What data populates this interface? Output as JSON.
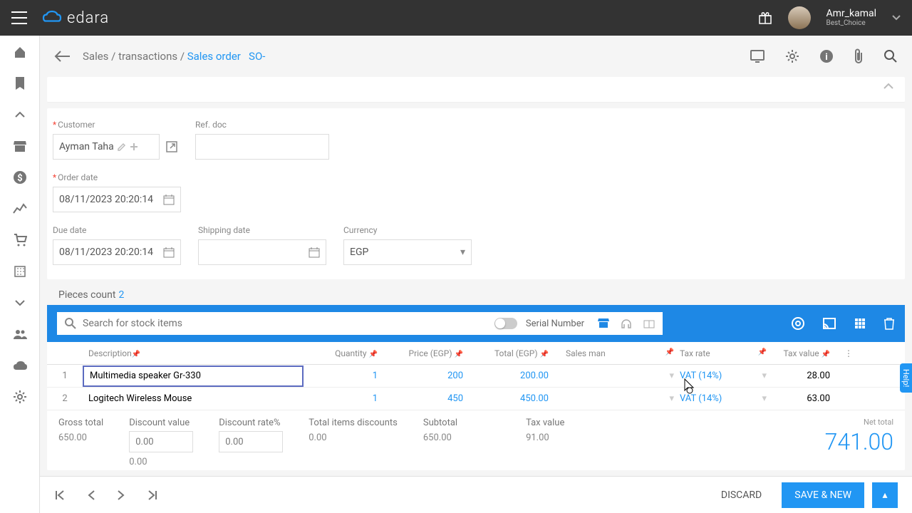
{
  "topbar": {
    "brand_text": "edara",
    "user_name": "Amr_kamal",
    "user_sub": "Best_Choice"
  },
  "breadcrumb": {
    "p1": "Sales",
    "p2": "transactions",
    "p3": "Sales order",
    "code": "SO-"
  },
  "form": {
    "customer_label": "Customer",
    "customer_value": "Ayman Taha",
    "ref_label": "Ref. doc",
    "order_date_label": "Order date",
    "order_date_value": "08/11/2023 20:20:14",
    "due_date_label": "Due date",
    "due_date_value": "08/11/2023 20:20:14",
    "shipping_label": "Shipping date",
    "currency_label": "Currency",
    "currency_value": "EGP"
  },
  "pieces": {
    "label": "Pieces count",
    "value": "2"
  },
  "search": {
    "placeholder": "Search for stock items",
    "serial": "Serial Number"
  },
  "columns": {
    "desc": "Description",
    "qty": "Quantity",
    "price": "Price (EGP)",
    "total": "Total (EGP)",
    "sales": "Sales man",
    "tax": "Tax rate",
    "taxv": "Tax value"
  },
  "rows": [
    {
      "n": "1",
      "desc": "Multimedia speaker Gr-330",
      "qty": "1",
      "price": "200",
      "total": "200.00",
      "tax": "VAT (14%)",
      "taxv": "28.00"
    },
    {
      "n": "2",
      "desc": "Logitech Wireless Mouse",
      "qty": "1",
      "price": "450",
      "total": "450.00",
      "tax": "VAT (14%)",
      "taxv": "63.00"
    }
  ],
  "totals": {
    "gross_l": "Gross total",
    "gross_v": "650.00",
    "discv_l": "Discount value",
    "discv_v": "0.00",
    "discv_sub": "0.00",
    "discr_l": "Discount rate%",
    "discr_v": "0.00",
    "items_l": "Total items discounts",
    "items_v": "0.00",
    "sub_l": "Subtotal",
    "sub_v": "650.00",
    "tax_l": "Tax value",
    "tax_v": "91.00",
    "net_l": "Net total",
    "net_v": "741.00"
  },
  "footer": {
    "discard": "DISCARD",
    "save": "SAVE & NEW"
  },
  "help": "Help!"
}
